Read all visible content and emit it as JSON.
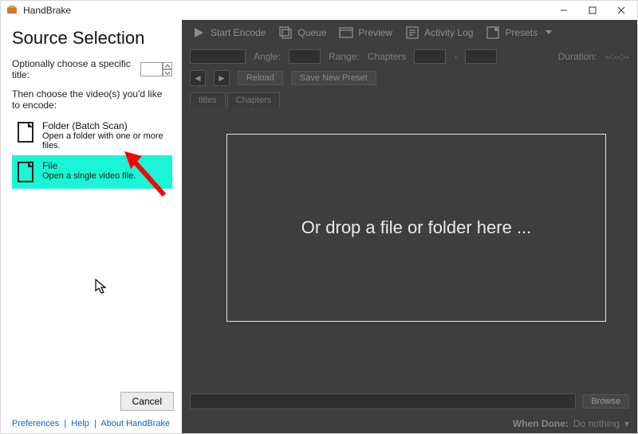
{
  "window": {
    "title": "HandBrake"
  },
  "toolbar": {
    "start_encode": "Start Encode",
    "queue": "Queue",
    "preview": "Preview",
    "activity_log": "Activity Log",
    "presets": "Presets"
  },
  "config": {
    "angle_label": "Angle:",
    "range_label": "Range:",
    "range_value": "Chapters",
    "through": "-",
    "duration_label": "Duration:",
    "duration_value": "--:--:--",
    "reload": "Reload",
    "save_new_preset": "Save New Preset"
  },
  "tabs": {
    "titles": "titles",
    "chapters": "Chapters"
  },
  "dropzone": {
    "text": "Or drop a file or folder here ..."
  },
  "bottom": {
    "browse": "Browse",
    "when_done_label": "When Done:",
    "when_done_value": "Do nothing",
    "caret": "▾"
  },
  "source": {
    "heading": "Source Selection",
    "opt_label": "Optionally choose a specific title:",
    "then": "Then choose the video(s) you'd like to encode:",
    "folder": {
      "t1": "Folder (Batch Scan)",
      "t2": "Open a folder with one or more files."
    },
    "file": {
      "t1": "File",
      "t2": "Open a single video file."
    },
    "cancel": "Cancel"
  },
  "links": {
    "preferences": "Preferences",
    "help": "Help",
    "about": "About HandBrake",
    "sep": "|"
  }
}
